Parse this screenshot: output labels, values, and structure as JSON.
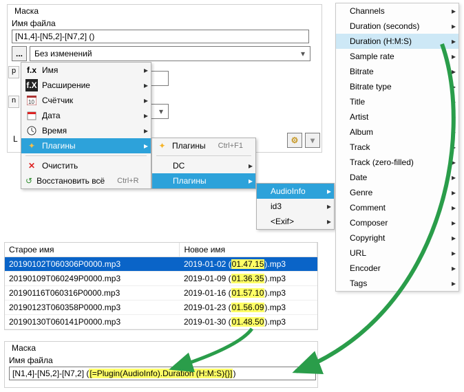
{
  "top_group": {
    "title": "Маска",
    "filename_label": "Имя файла",
    "filename_value": "[N1,4]-[N5,2]-[N7,2] ()",
    "browse_label": "...",
    "dropdown_value": "Без изменений",
    "L_label": "L"
  },
  "left_badges": {
    "p": "p",
    "n": "n"
  },
  "main_menu": {
    "name": "Имя",
    "ext": "Расширение",
    "counter": "Счётчик",
    "date": "Дата",
    "time": "Время",
    "plugins": "Плагины",
    "clear": "Очистить",
    "restore": "Восстановить всё",
    "restore_shortcut": "Ctrl+R"
  },
  "submenu1": {
    "plugins": "Плагины",
    "plugins_shortcut": "Ctrl+F1",
    "dc": "DC",
    "plugins2": "Плагины"
  },
  "submenu2": {
    "audioinfo": "AudioInfo",
    "id3": "id3",
    "exif": "<Exif>"
  },
  "right_menu": {
    "items": [
      "Channels",
      "Duration (seconds)",
      "Duration (H:M:S)",
      "Sample rate",
      "Bitrate",
      "Bitrate type",
      "Title",
      "Artist",
      "Album",
      "Track",
      "Track (zero-filled)",
      "Date",
      "Genre",
      "Comment",
      "Composer",
      "Copyright",
      "URL",
      "Encoder",
      "Tags"
    ],
    "highlight_index": 2
  },
  "table": {
    "col1": "Старое имя",
    "col2": "Новое имя",
    "rows": [
      {
        "old": "20190102T060306P0000.mp3",
        "new_prefix": "2019-01-02 (",
        "new_dur": "01.47.15",
        "new_suffix": ").mp3",
        "selected": true
      },
      {
        "old": "20190109T060249P0000.mp3",
        "new_prefix": "2019-01-09 (",
        "new_dur": "01.36.35",
        "new_suffix": ").mp3",
        "selected": false
      },
      {
        "old": "20190116T060316P0000.mp3",
        "new_prefix": "2019-01-16 (",
        "new_dur": "01.57.10",
        "new_suffix": ").mp3",
        "selected": false
      },
      {
        "old": "20190123T060358P0000.mp3",
        "new_prefix": "2019-01-23 (",
        "new_dur": "01.56.09",
        "new_suffix": ").mp3",
        "selected": false
      },
      {
        "old": "20190130T060141P0000.mp3",
        "new_prefix": "2019-01-30 (",
        "new_dur": "01.48.50",
        "new_suffix": ").mp3",
        "selected": false
      }
    ]
  },
  "bottom_group": {
    "title": "Маска",
    "filename_label": "Имя файла",
    "filename_prefix": "[N1,4]-[N5,2]-[N7,2] (",
    "filename_highlight": "[=Plugin(AudioInfo).Duration (H:M:S){}]",
    "filename_suffix": ")"
  }
}
